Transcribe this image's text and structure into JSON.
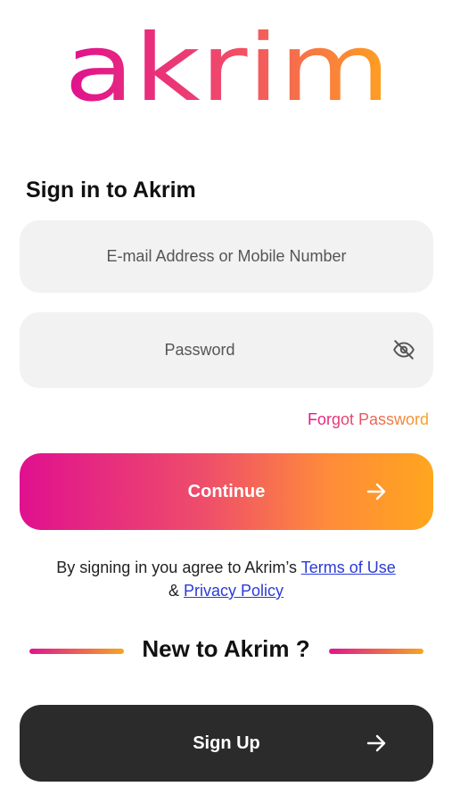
{
  "brand": {
    "logo_text": "akrim",
    "gradient_start": "#e0108f",
    "gradient_end": "#ffa61e"
  },
  "signin": {
    "title": "Sign in to Akrim",
    "email_placeholder": "E-mail Address or Mobile Number",
    "password_placeholder": "Password",
    "password_toggle_icon": "eye-slash-icon",
    "forgot_label": "Forgot Password",
    "continue_label": "Continue",
    "continue_icon": "arrow-right-icon"
  },
  "legal": {
    "prefix": "By signing in you agree to Akrim’s",
    "terms_label": "Terms of Use",
    "ampersand": "&",
    "privacy_label": "Privacy Policy",
    "link_color": "#2a3bd6"
  },
  "signup": {
    "heading": "New to Akrim ?",
    "button_label": "Sign Up",
    "button_color": "#2b2b2b",
    "button_icon": "arrow-right-icon"
  }
}
